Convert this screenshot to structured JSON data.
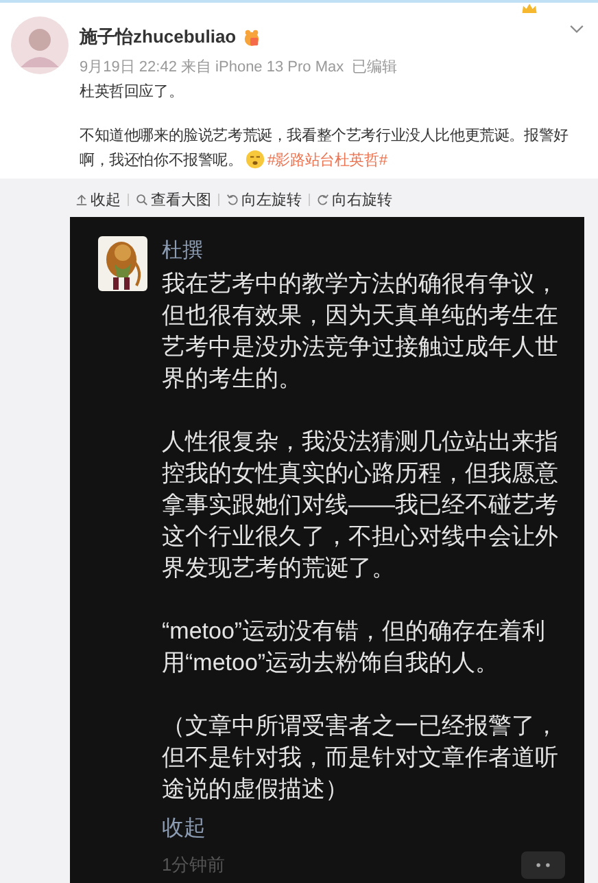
{
  "post": {
    "author": "施子怡zhucebuliao",
    "verified_badge": true,
    "meta": "9月19日 22:42 来自 iPhone 13 Pro Max  已编辑",
    "paragraphs": [
      {
        "text": "杜英哲回应了。"
      },
      {
        "text": "不知道他哪来的脸说艺考荒诞，我看整个艺考行业没人比他更荒诞。报警好啊，我还怕你不报警呢。",
        "emoji": true,
        "hashtag": "#影路站台杜英哲#"
      }
    ]
  },
  "image_toolbar": [
    {
      "label": "收起",
      "kind": "collapse"
    },
    {
      "label": "查看大图",
      "kind": "zoom"
    },
    {
      "label": "向左旋转",
      "kind": "rotateleft"
    },
    {
      "label": "向右旋转",
      "kind": "rotateright"
    }
  ],
  "image": {
    "commenter": "杜撰",
    "paragraphs": [
      {
        "lines": [
          "我在艺考中的教学方法的确很有争议，",
          "但也很有效果，因为天真单纯的考生在",
          "艺考中是没办法竞争过接触过成年人世",
          "界的考生的。"
        ]
      },
      {
        "lines": [
          "人性很复杂，我没法猜测几位站出来指",
          "控我的女性真实的心路历程，但我愿意",
          "拿事实跟她们对线——我已经不碰艺考",
          "这个行业很久了，不担心对线中会让外",
          "界发现艺考的荒诞了。"
        ]
      },
      {
        "lines": [
          "“metoo”运动没有错，但的确存在着利",
          "用“metoo”运动去粉饰自我的人。"
        ]
      },
      {
        "lines": [
          "（文章中所谓受害者之一已经报警了，",
          "但不是针对我，而是针对文章作者道听",
          "途说的虚假描述）"
        ]
      }
    ],
    "collapse": "收起",
    "time": "1分钟前"
  }
}
